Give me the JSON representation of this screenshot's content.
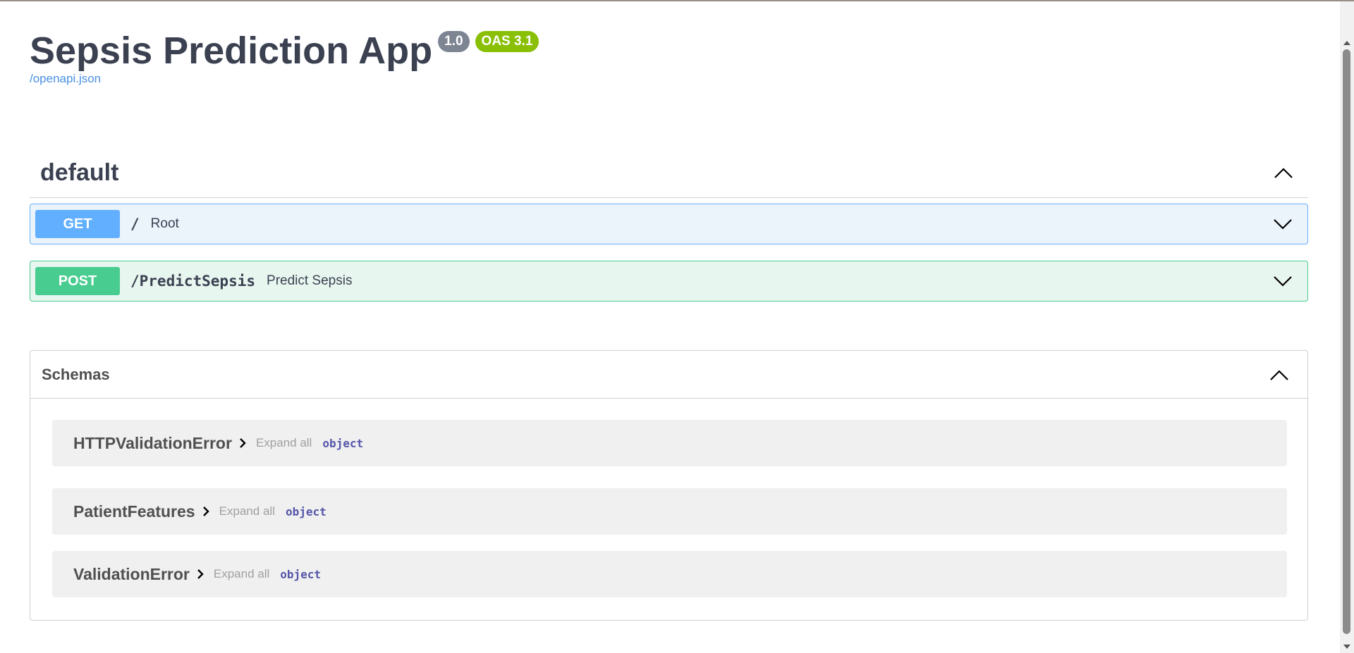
{
  "header": {
    "title": "Sepsis Prediction App",
    "version_badge": "1.0",
    "oas_badge": "OAS 3.1",
    "spec_link": "/openapi.json"
  },
  "tag": {
    "name": "default",
    "icon": "chevron-up-icon"
  },
  "operations": [
    {
      "method": "GET",
      "path": "/",
      "summary": "Root",
      "color": "#61affe"
    },
    {
      "method": "POST",
      "path": "/PredictSepsis",
      "summary": "Predict Sepsis",
      "color": "#49cc90"
    }
  ],
  "schemas": {
    "title": "Schemas",
    "items": [
      {
        "name": "HTTPValidationError",
        "expand_label": "Expand all",
        "type": "object"
      },
      {
        "name": "PatientFeatures",
        "expand_label": "Expand all",
        "type": "object"
      },
      {
        "name": "ValidationError",
        "expand_label": "Expand all",
        "type": "object"
      }
    ]
  },
  "colors": {
    "version_badge": "#7d8492",
    "oas_badge": "#89bf04",
    "link": "#4990e2"
  }
}
